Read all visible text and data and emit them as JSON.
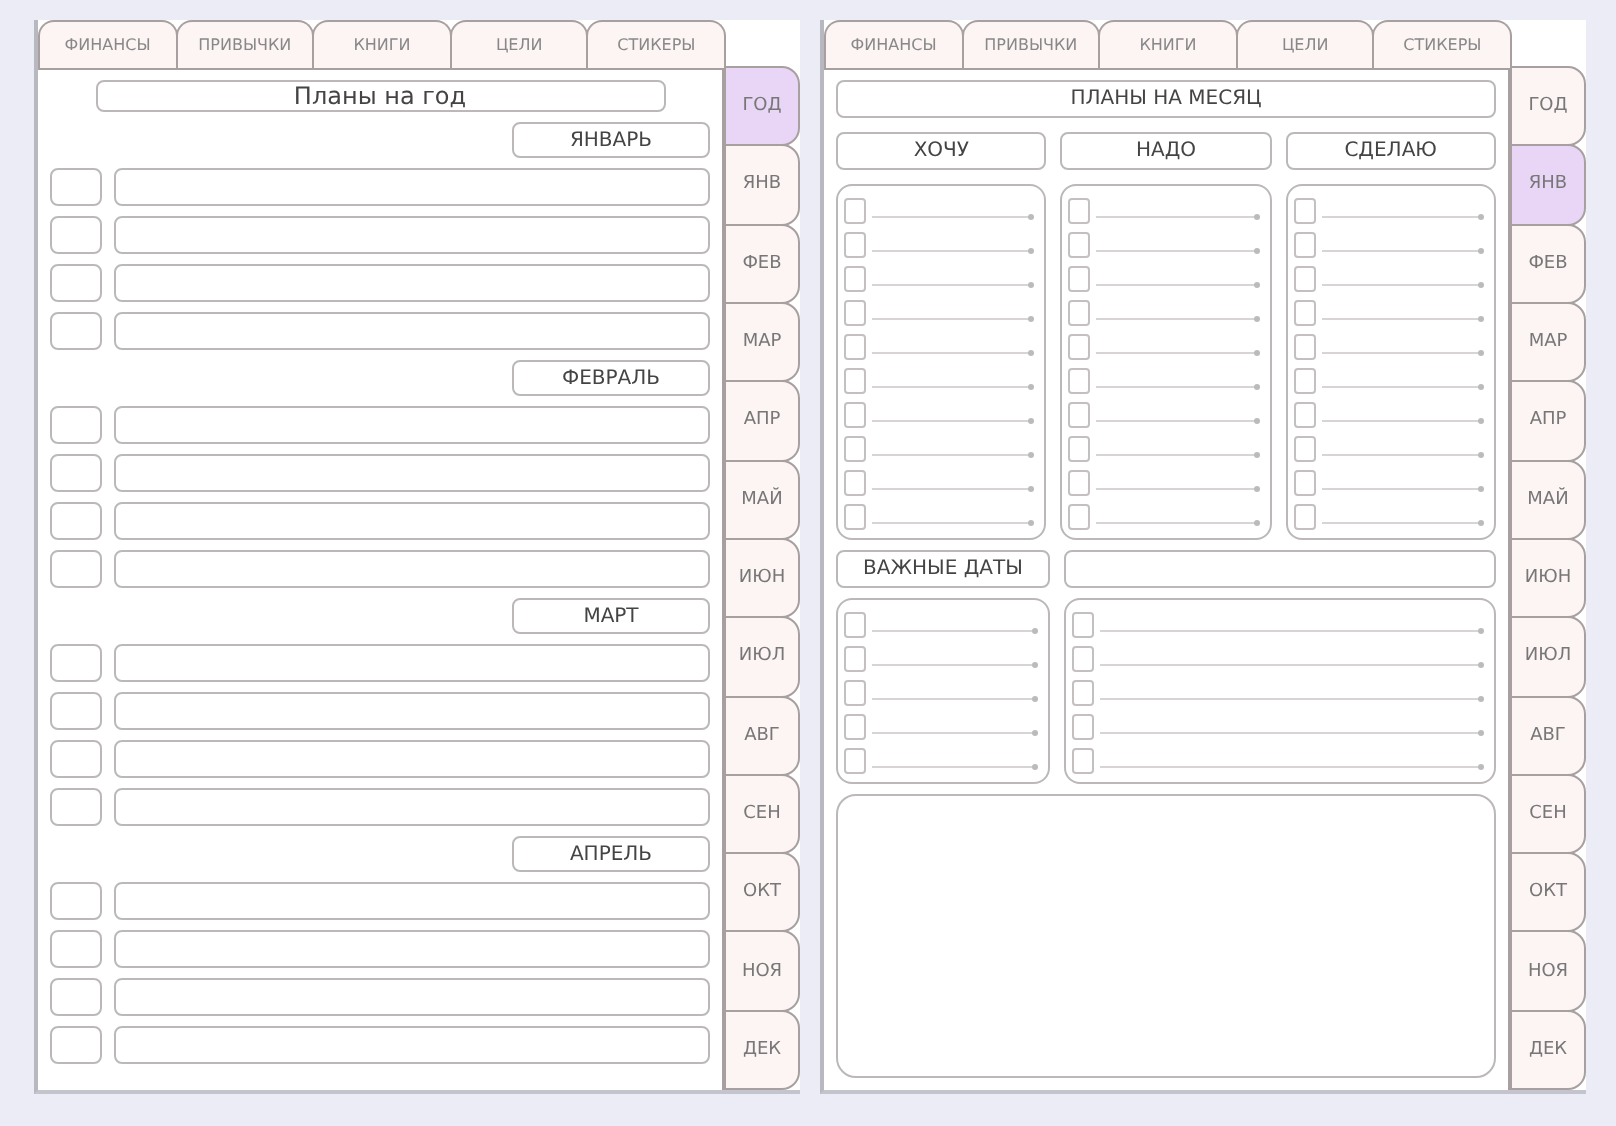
{
  "pages": [
    {
      "kind": "year",
      "top_tabs": [
        {
          "label": "ФИНАНСЫ"
        },
        {
          "label": "ПРИВЫЧКИ"
        },
        {
          "label": "КНИГИ"
        },
        {
          "label": "ЦЕЛИ"
        },
        {
          "label": "СТИКЕРЫ"
        }
      ],
      "side_tabs": [
        {
          "label": "ГОД",
          "selected": true
        },
        {
          "label": "ЯНВ",
          "selected": false
        },
        {
          "label": "ФЕВ",
          "selected": false
        },
        {
          "label": "МАР",
          "selected": false
        },
        {
          "label": "АПР",
          "selected": false
        },
        {
          "label": "МАЙ",
          "selected": false
        },
        {
          "label": "ИЮН",
          "selected": false
        },
        {
          "label": "ИЮЛ",
          "selected": false
        },
        {
          "label": "АВГ",
          "selected": false
        },
        {
          "label": "СЕН",
          "selected": false
        },
        {
          "label": "ОКТ",
          "selected": false
        },
        {
          "label": "НОЯ",
          "selected": false
        },
        {
          "label": "ДЕК",
          "selected": false
        }
      ],
      "title": "Планы на год",
      "months": [
        "ЯНВАРЬ",
        "ФЕВРАЛЬ",
        "МАРТ",
        "АПРЕЛЬ"
      ]
    },
    {
      "kind": "month",
      "top_tabs": [
        {
          "label": "ФИНАНСЫ"
        },
        {
          "label": "ПРИВЫЧКИ"
        },
        {
          "label": "КНИГИ"
        },
        {
          "label": "ЦЕЛИ"
        },
        {
          "label": "СТИКЕРЫ"
        }
      ],
      "side_tabs": [
        {
          "label": "ГОД",
          "selected": false
        },
        {
          "label": "ЯНВ",
          "selected": true
        },
        {
          "label": "ФЕВ",
          "selected": false
        },
        {
          "label": "МАР",
          "selected": false
        },
        {
          "label": "АПР",
          "selected": false
        },
        {
          "label": "МАЙ",
          "selected": false
        },
        {
          "label": "ИЮН",
          "selected": false
        },
        {
          "label": "ИЮЛ",
          "selected": false
        },
        {
          "label": "АВГ",
          "selected": false
        },
        {
          "label": "СЕН",
          "selected": false
        },
        {
          "label": "ОКТ",
          "selected": false
        },
        {
          "label": "НОЯ",
          "selected": false
        },
        {
          "label": "ДЕК",
          "selected": false
        }
      ],
      "title": "ПЛАНЫ НА МЕСЯЦ",
      "columns": [
        {
          "label": "ХОЧУ",
          "items": [
            {
              "checked": false
            },
            {
              "checked": false
            },
            {
              "checked": false
            },
            {
              "checked": false
            },
            {
              "checked": false
            },
            {
              "checked": false
            },
            {
              "checked": false
            },
            {
              "checked": false
            },
            {
              "checked": false
            },
            {
              "checked": false
            }
          ]
        },
        {
          "label": "НАДО",
          "items": [
            {
              "checked": false
            },
            {
              "checked": false
            },
            {
              "checked": false
            },
            {
              "checked": false
            },
            {
              "checked": false
            },
            {
              "checked": false
            },
            {
              "checked": false
            },
            {
              "checked": false
            },
            {
              "checked": false
            },
            {
              "checked": false
            }
          ]
        },
        {
          "label": "СДЕЛАЮ",
          "items": [
            {
              "checked": false
            },
            {
              "checked": false
            },
            {
              "checked": false
            },
            {
              "checked": false
            },
            {
              "checked": false
            },
            {
              "checked": false
            },
            {
              "checked": false
            },
            {
              "checked": false
            },
            {
              "checked": false
            },
            {
              "checked": false
            }
          ]
        }
      ],
      "dates_label": "ВАЖНЫЕ ДАТЫ",
      "date_lists": [
        {
          "items": [
            {
              "checked": false
            },
            {
              "checked": false
            },
            {
              "checked": false
            },
            {
              "checked": false
            },
            {
              "checked": false
            }
          ]
        },
        {
          "items": [
            {
              "checked": false
            },
            {
              "checked": false
            },
            {
              "checked": false
            },
            {
              "checked": false
            },
            {
              "checked": false
            }
          ]
        }
      ]
    }
  ]
}
